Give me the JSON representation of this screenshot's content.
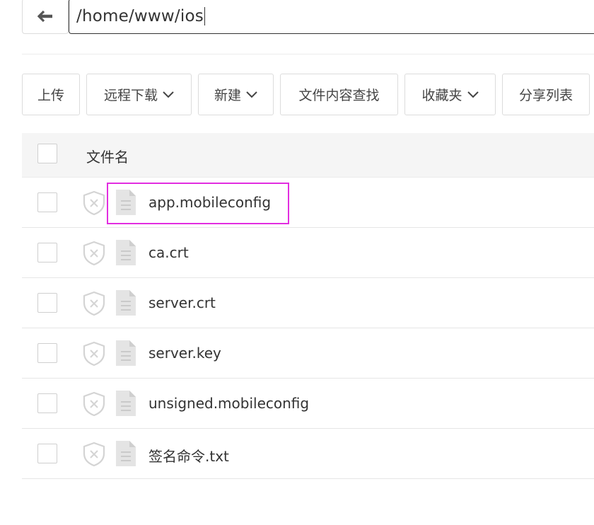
{
  "path_bar": {
    "path": "/home/www/ios"
  },
  "toolbar": {
    "buttons": [
      {
        "label": "上传",
        "has_dropdown": false
      },
      {
        "label": "远程下载",
        "has_dropdown": true
      },
      {
        "label": "新建",
        "has_dropdown": true
      },
      {
        "label": "文件内容查找",
        "has_dropdown": false
      },
      {
        "label": "收藏夹",
        "has_dropdown": true
      },
      {
        "label": "分享列表",
        "has_dropdown": false
      }
    ]
  },
  "table": {
    "header": {
      "name_label": "文件名"
    },
    "rows": [
      {
        "name": "app.mobileconfig",
        "highlighted": true
      },
      {
        "name": "ca.crt",
        "highlighted": false
      },
      {
        "name": "server.crt",
        "highlighted": false
      },
      {
        "name": "server.key",
        "highlighted": false
      },
      {
        "name": "unsigned.mobileconfig",
        "highlighted": false
      },
      {
        "name": "签名命令.txt",
        "highlighted": false
      }
    ]
  },
  "icons": {
    "back": "arrow-left-icon",
    "dropdown": "chevron-down-icon",
    "protect": "shield-x-icon",
    "file": "file-icon"
  },
  "colors": {
    "highlight_border": "#e22ee0",
    "icon_gray": "#d4d4d4",
    "text": "#333333"
  }
}
